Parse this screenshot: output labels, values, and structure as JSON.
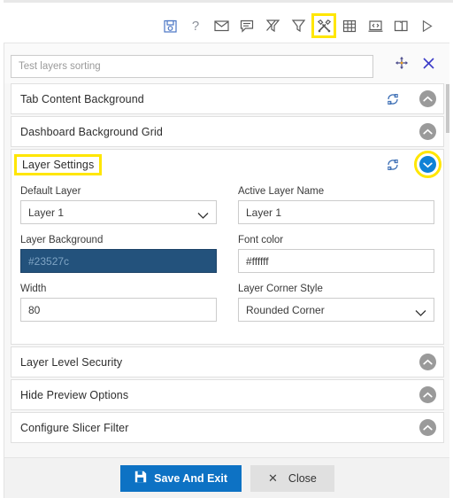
{
  "toolbar": {
    "icons": [
      {
        "name": "save-icon",
        "label": "Save",
        "highlight": false
      },
      {
        "name": "help-question-icon",
        "label": "?",
        "highlight": false
      },
      {
        "name": "mail-envelope-icon",
        "label": "Mail",
        "highlight": false
      },
      {
        "name": "comment-icon",
        "label": "Comment",
        "highlight": false
      },
      {
        "name": "clear-filter-icon",
        "label": "Clear Filter",
        "highlight": false
      },
      {
        "name": "filter-icon",
        "label": "Filter",
        "highlight": false
      },
      {
        "name": "tools-settings-icon",
        "label": "Settings",
        "highlight": true
      },
      {
        "name": "table-grid-icon",
        "label": "Grid",
        "highlight": false
      },
      {
        "name": "code-window-icon",
        "label": "Code",
        "highlight": false
      },
      {
        "name": "copy-window-icon",
        "label": "Duplicate",
        "highlight": false
      },
      {
        "name": "play-preview-icon",
        "label": "Preview",
        "highlight": false
      }
    ]
  },
  "dialog": {
    "search": {
      "value": "",
      "placeholder": "Test layers sorting"
    },
    "move_icon": "move-handle-icon",
    "close_icon": "close-icon"
  },
  "sections": [
    {
      "title": "Tab Content Background",
      "has_sync": true,
      "expanded": false,
      "highlight": false
    },
    {
      "title": "Dashboard Background Grid",
      "has_sync": false,
      "expanded": false,
      "highlight": false
    },
    {
      "title": "Layer Settings",
      "has_sync": true,
      "expanded": true,
      "highlight": true
    },
    {
      "title": "Layer Level Security",
      "has_sync": false,
      "expanded": false,
      "highlight": false
    },
    {
      "title": "Hide Preview Options",
      "has_sync": false,
      "expanded": false,
      "highlight": false
    },
    {
      "title": "Configure Slicer Filter",
      "has_sync": false,
      "expanded": false,
      "highlight": false
    }
  ],
  "layer_settings": {
    "default_layer": {
      "label": "Default Layer",
      "value": "Layer 1",
      "type": "select"
    },
    "active_layer_name": {
      "label": "Active Layer Name",
      "value": "Layer 1",
      "type": "text"
    },
    "layer_background": {
      "label": "Layer Background",
      "value": "#23527c",
      "type": "color",
      "swatch": "#23527c"
    },
    "font_color": {
      "label": "Font color",
      "value": "#ffffff",
      "type": "color"
    },
    "width": {
      "label": "Width",
      "value": "80",
      "type": "text"
    },
    "layer_corner_style": {
      "label": "Layer Corner Style",
      "value": "Rounded Corner",
      "type": "select"
    }
  },
  "footer": {
    "save_label": "Save And Exit",
    "save_icon": "save-floppy-icon",
    "close_label": "Close",
    "close_icon": "close-x-icon"
  },
  "colors": {
    "accent_blue": "#0d72c4",
    "highlight_yellow": "#ffe600",
    "swatch_blue": "#23527c",
    "chevron_gray": "#9a9a9a",
    "chevron_active": "#0f82d6"
  }
}
